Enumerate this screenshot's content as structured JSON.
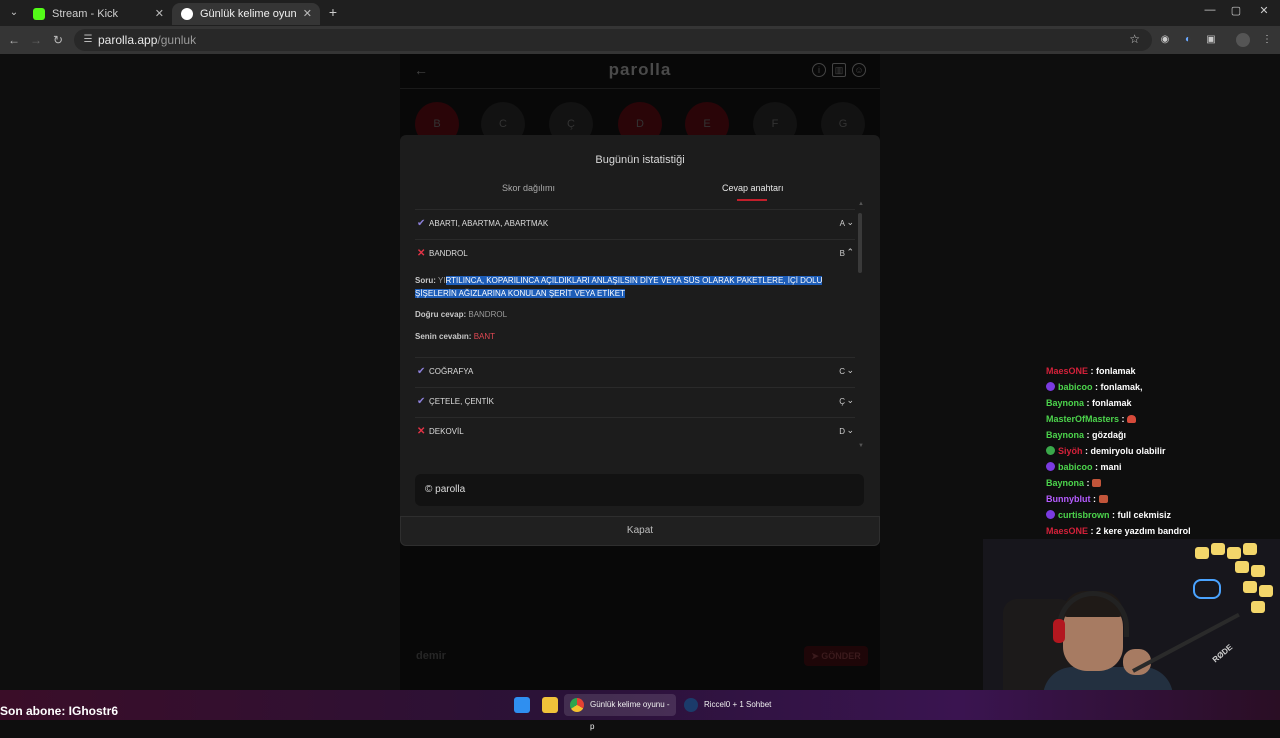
{
  "browser": {
    "tabs": [
      {
        "title": "Stream - Kick Dashboard",
        "favicon": "kick-icon",
        "active": false
      },
      {
        "title": "Günlük kelime oyunu - parolla",
        "favicon": "parolla-icon",
        "active": true
      }
    ],
    "url_host": "parolla.app",
    "url_path": "/gunluk"
  },
  "page": {
    "logo": "parolla",
    "letters": [
      "B",
      "C",
      "Ç",
      "D",
      "E",
      "F",
      "G"
    ],
    "input_placeholder": "demir",
    "send_label": "GÖNDER"
  },
  "modal": {
    "title": "Bugünün istatistiği",
    "tabs": [
      "Skor dağılımı",
      "Cevap anahtarı"
    ],
    "active_tab": 1,
    "rows": [
      {
        "status": "correct",
        "word": "ABARTI, ABARTMA, ABARTMAK",
        "letter": "A",
        "expanded": false
      },
      {
        "status": "wrong",
        "word": "BANDROL",
        "letter": "B",
        "expanded": true
      },
      {
        "status": "correct",
        "word": "COĞRAFYA",
        "letter": "C",
        "expanded": false
      },
      {
        "status": "correct",
        "word": "ÇETELE, ÇENTİK",
        "letter": "Ç",
        "expanded": false
      },
      {
        "status": "wrong",
        "word": "DEKOVİL",
        "letter": "D",
        "expanded": false
      }
    ],
    "detail": {
      "question_label": "Soru:",
      "question_pre": "YI",
      "question_selected_1": "RTILINCA, KOPARILINCA AÇILDIKLARI ANLAŞILSIN DİYE VEYA SÜS OLARAK PAKETLERE, İÇİ DOLU",
      "question_selected_2": "ŞİŞELERİN AĞIZLARINA KONULAN ŞERİT VEYA ETİKET",
      "correct_label": "Doğru cevap:",
      "correct_value": "BANDROL",
      "yours_label": "Senin cevabın:",
      "yours_value": "BANT"
    },
    "footer": "© parolla",
    "close_label": "Kapat"
  },
  "chat": [
    {
      "user": "MaesONE",
      "color": "#d4213a",
      "badge": false,
      "msg": ": fonlamak"
    },
    {
      "user": "babicoo",
      "color": "#4cd44c",
      "badge": true,
      "badge_color": "#7a3be0",
      "msg": ": fonlamak,"
    },
    {
      "user": "Baynona",
      "color": "#4cd44c",
      "badge": false,
      "msg": ": fonlamak"
    },
    {
      "user": "MasterOfMasters",
      "color": "#4cd44c",
      "badge": false,
      "msg": ":"
    },
    {
      "user": "Baynona",
      "color": "#4cd44c",
      "badge": false,
      "msg": ": gözdağı"
    },
    {
      "user": "Siyöh",
      "color": "#d4213a",
      "badge": true,
      "badge_color": "#3aa84a",
      "msg": ": demiryolu olabilir"
    },
    {
      "user": "babicoo",
      "color": "#4cd44c",
      "badge": true,
      "badge_color": "#7a3be0",
      "msg": ": mani"
    },
    {
      "user": "Baynona",
      "color": "#4cd44c",
      "badge": false,
      "msg": ":"
    },
    {
      "user": "Bunnyblut",
      "color": "#b55cff",
      "badge": false,
      "msg": ":"
    },
    {
      "user": "curtisbrown",
      "color": "#4cd44c",
      "badge": true,
      "badge_color": "#7a3be0",
      "msg": ": full cekmisiz"
    },
    {
      "user": "MaesONE",
      "color": "#d4213a",
      "badge": false,
      "msg": ": 2 kere yazdım bandrol"
    }
  ],
  "webcam": {
    "mic_brand": "RØDE"
  },
  "subscriber": "Son abone: IGhostr6",
  "taskbar": {
    "chrome_item": "Günlük kelime oyunu - p",
    "steam_item": "Riccel0 + 1 Sohbet"
  },
  "colors": {
    "accent_red": "#e33346",
    "check_purple": "#8b7fd8",
    "selection_blue": "#1d5db8"
  }
}
